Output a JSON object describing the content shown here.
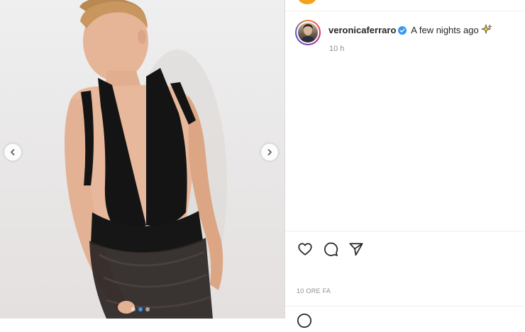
{
  "post": {
    "username": "veronicaferraro",
    "verified": true,
    "caption": "A few nights ago",
    "caption_emoji": "sparkles",
    "caption_time": "10 h",
    "post_time": "10 ORE FA"
  },
  "carousel": {
    "slides": 3,
    "active_index": 1
  },
  "icons": {
    "prev": "chevron-left-icon",
    "next": "chevron-right-icon",
    "like": "heart-icon",
    "comment": "comment-bubble-icon",
    "share": "paper-plane-icon",
    "emoji": "emoji-icon",
    "verified": "verified-badge-icon"
  },
  "colors": {
    "verified_blue": "#3897f0",
    "text": "#262626",
    "muted": "#8e8e8e",
    "divider": "#efefef"
  }
}
